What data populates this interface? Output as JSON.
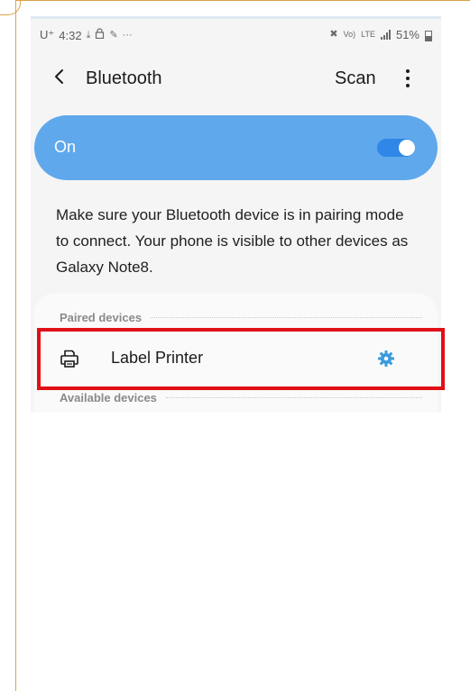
{
  "status_bar": {
    "carrier": "U⁺",
    "time": "4:32",
    "left_icons": [
      "download-icon",
      "lock-icon",
      "pen-icon",
      "more-notifications-icon"
    ],
    "more_notifications": "···",
    "right_icons": [
      "mute-icon",
      "volte-icon",
      "lte-icon",
      "signal-icon",
      "battery-icon"
    ],
    "volte_label": "Vo)",
    "lte_label": "LTE",
    "battery_percent": "51%"
  },
  "header": {
    "title": "Bluetooth",
    "scan_label": "Scan",
    "back_icon": "chevron-left-icon",
    "more_icon": "more-vertical-icon"
  },
  "bluetooth_toggle": {
    "label": "On",
    "enabled": true,
    "background_color": "#5fa8ec",
    "switch_color": "#2f87e7"
  },
  "description": "Make sure your Bluetooth device is in pairing mode to connect. Your phone is visible to other devices as Galaxy Note8.",
  "paired_section": {
    "title": "Paired devices",
    "devices": [
      {
        "name": "Label Printer",
        "icon": "printer-icon",
        "settings_icon": "gear-icon",
        "settings_color": "#3a9bdc"
      }
    ]
  },
  "available_section": {
    "title": "Available devices"
  },
  "highlight": {
    "color": "#e01017",
    "target": "Label Printer"
  }
}
